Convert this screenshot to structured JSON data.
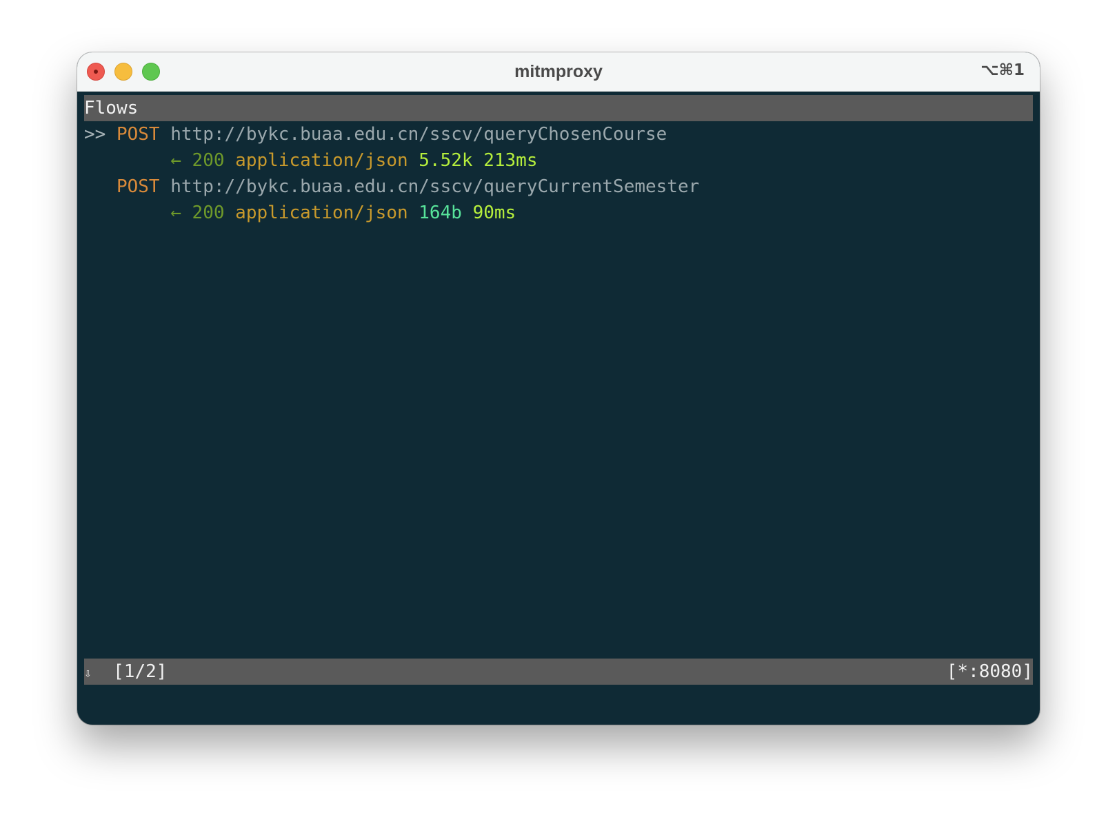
{
  "window": {
    "title": "mitmproxy",
    "shortcut": "⌥⌘1"
  },
  "header": {
    "label": "Flows"
  },
  "flows": [
    {
      "cursor": ">>",
      "method": "POST",
      "url": "http://bykc.buaa.edu.cn/sscv/queryChosenCourse",
      "arrow": "←",
      "status": "200",
      "content_type": "application/json",
      "size": "5.52k",
      "time": "213ms"
    },
    {
      "cursor": "",
      "method": "POST",
      "url": "http://bykc.buaa.edu.cn/sscv/queryCurrentSemester",
      "arrow": "←",
      "status": "200",
      "content_type": "application/json",
      "size": "164b",
      "time": "90ms"
    }
  ],
  "footer": {
    "scroll_icon": "⇩",
    "position": "[1/2]",
    "listen": "[*:8080]"
  },
  "icons": {
    "close": "close-icon",
    "minimize": "minimize-icon",
    "maximize": "maximize-icon"
  },
  "colors": {
    "terminal_bg": "#0f2a35",
    "bar_bg": "#5a5a5a",
    "method": "#d98a3a",
    "url": "#9ba8ad",
    "status": "#6f9a2a",
    "content_type": "#c99a2c",
    "size_time": "#b6ef3c",
    "small_size": "#57e39a"
  }
}
